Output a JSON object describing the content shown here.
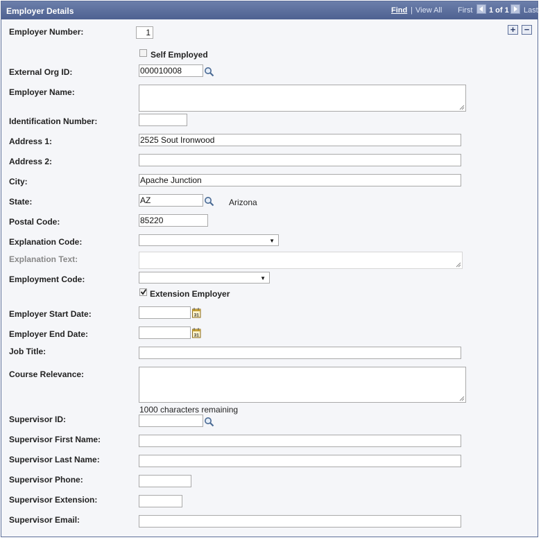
{
  "header": {
    "title": "Employer Details",
    "find": "Find",
    "separator": "|",
    "view_all": "View All",
    "first": "First",
    "page_position": "1 of 1",
    "last": "Last"
  },
  "row_controls": {
    "add": "+",
    "remove": "−"
  },
  "fields": {
    "employer_number": {
      "label": "Employer Number:",
      "value": "1"
    },
    "self_employed": {
      "label": "Self Employed",
      "checked": false
    },
    "external_org_id": {
      "label": "External Org ID:",
      "value": "000010008"
    },
    "employer_name": {
      "label": "Employer Name:",
      "value": ""
    },
    "identification_number": {
      "label": "Identification Number:",
      "value": ""
    },
    "address1": {
      "label": "Address 1:",
      "value": "2525 Sout Ironwood"
    },
    "address2": {
      "label": "Address 2:",
      "value": ""
    },
    "city": {
      "label": "City:",
      "value": "Apache Junction"
    },
    "state": {
      "label": "State:",
      "value": "AZ",
      "description": "Arizona"
    },
    "postal_code": {
      "label": "Postal Code:",
      "value": "85220"
    },
    "explanation_code": {
      "label": "Explanation Code:",
      "value": ""
    },
    "explanation_text": {
      "label": "Explanation Text:",
      "value": ""
    },
    "employment_code": {
      "label": "Employment Code:",
      "value": ""
    },
    "extension_employer": {
      "label": "Extension Employer",
      "checked": true
    },
    "employer_start_date": {
      "label": "Employer Start Date:",
      "value": ""
    },
    "employer_end_date": {
      "label": "Employer End Date:",
      "value": ""
    },
    "job_title": {
      "label": "Job Title:",
      "value": ""
    },
    "course_relevance": {
      "label": "Course Relevance:",
      "value": "",
      "remaining": "1000 characters remaining"
    },
    "supervisor_id": {
      "label": "Supervisor ID:",
      "value": ""
    },
    "supervisor_first_name": {
      "label": "Supervisor First Name:",
      "value": ""
    },
    "supervisor_last_name": {
      "label": "Supervisor Last Name:",
      "value": ""
    },
    "supervisor_phone": {
      "label": "Supervisor Phone:",
      "value": ""
    },
    "supervisor_extension": {
      "label": "Supervisor Extension:",
      "value": ""
    },
    "supervisor_email": {
      "label": "Supervisor Email:",
      "value": ""
    }
  },
  "icons": {
    "lookup": "magnifier-icon",
    "calendar": "calendar-icon",
    "calendar_text": "31"
  },
  "colors": {
    "header_bg": "#5a6d9c",
    "panel_bg": "#f5f6f9",
    "border": "#5c6e98"
  }
}
